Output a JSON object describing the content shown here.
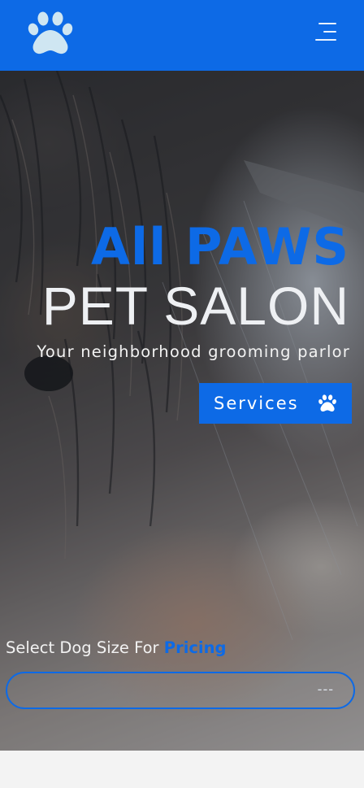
{
  "header": {
    "logo_icon": "paw-icon",
    "menu_icon": "hamburger-menu-icon",
    "background": "#0d6ae6"
  },
  "hero": {
    "title_main": "All PAWS",
    "title_sub": "PET SALON",
    "tagline": "Your neighborhood grooming parlor",
    "services_button": {
      "label": "Services",
      "icon": "paw-icon"
    }
  },
  "pricing": {
    "label_prefix": "Select Dog Size For",
    "label_accent": "Pricing",
    "select_value": "---"
  },
  "colors": {
    "accent": "#0d6ae6",
    "hero_text": "#eef0f3"
  }
}
